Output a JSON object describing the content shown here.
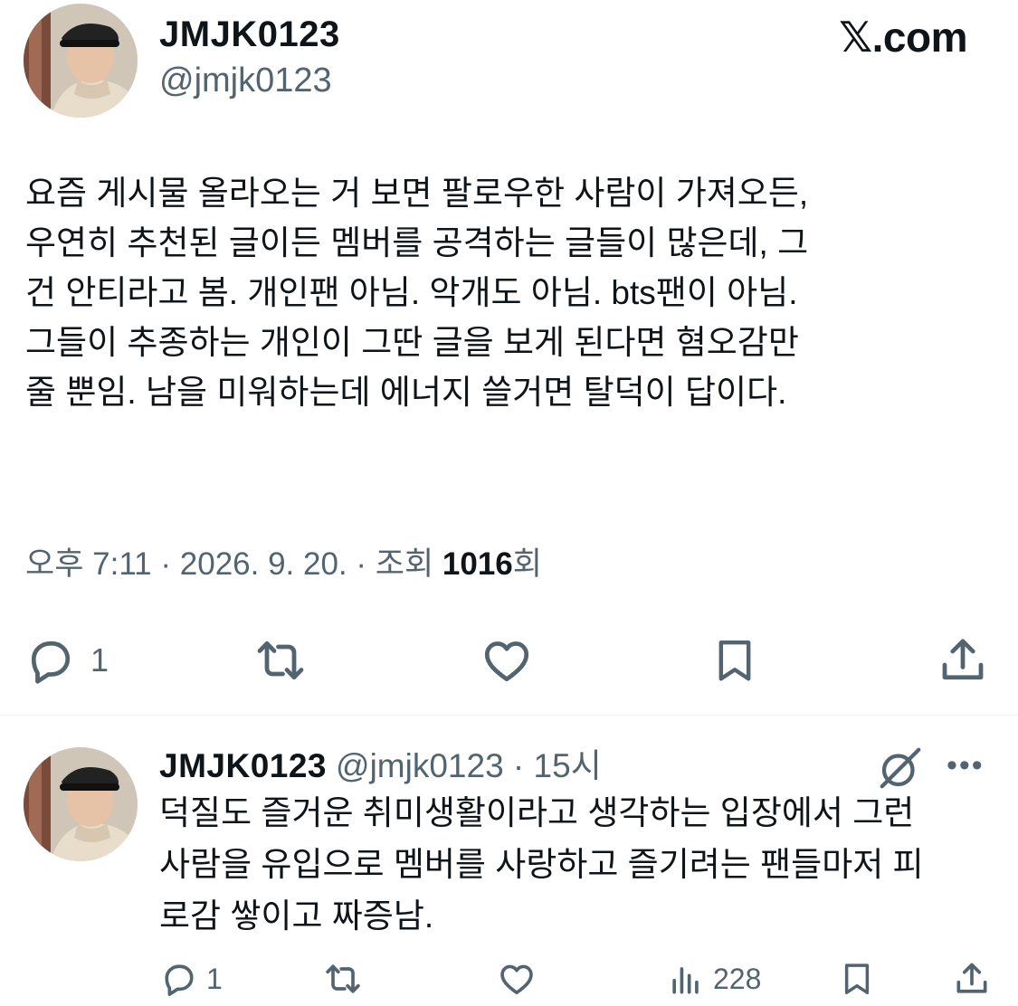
{
  "brand": {
    "logo_text": "𝕏.com"
  },
  "tweet": {
    "author": {
      "display_name": "JMJK0123",
      "handle": "@jmjk0123"
    },
    "text": "요즘 게시물 올라오는 거 보면 팔로우한 사람이 가져오든,\n우연히 추천된 글이든 멤버를 공격하는 글들이 많은데, 그\n건 안티라고 봄. 개인팬 아님. 악개도 아님. bts팬이 아님.\n그들이 추종하는 개인이 그딴 글을 보게 된다면 혐오감만\n줄 뿐임. 남을 미워하는데 에너지 쓸거면 탈덕이 답이다.",
    "meta": {
      "time": "오후 7:11",
      "sep1": " · ",
      "date": "2026. 9. 20.",
      "sep2": " · ",
      "views_label": "조회 ",
      "views_count": "1016",
      "views_suffix": "회"
    },
    "actions": {
      "reply_count": "1",
      "icons": [
        "reply-icon",
        "retweet-icon",
        "like-icon",
        "bookmark-icon",
        "share-icon"
      ]
    }
  },
  "reply": {
    "author": {
      "display_name": "JMJK0123",
      "handle": "@jmjk0123",
      "sep": " · ",
      "time": "15시"
    },
    "text": "덕질도 즐거운 취미생활이라고 생각하는 입장에서 그런\n사람을 유입으로 멤버를 사랑하고 즐기려는 팬들마저 피\n로감 쌓이고 짜증남.",
    "actions": {
      "reply_count": "1",
      "views_count": "228",
      "icons": [
        "reply-icon",
        "retweet-icon",
        "like-icon",
        "views-icon",
        "bookmark-icon",
        "share-icon"
      ]
    },
    "more": "•••"
  },
  "colors": {
    "text": "#0f1419",
    "secondary": "#536471",
    "divider": "#eff3f4"
  }
}
